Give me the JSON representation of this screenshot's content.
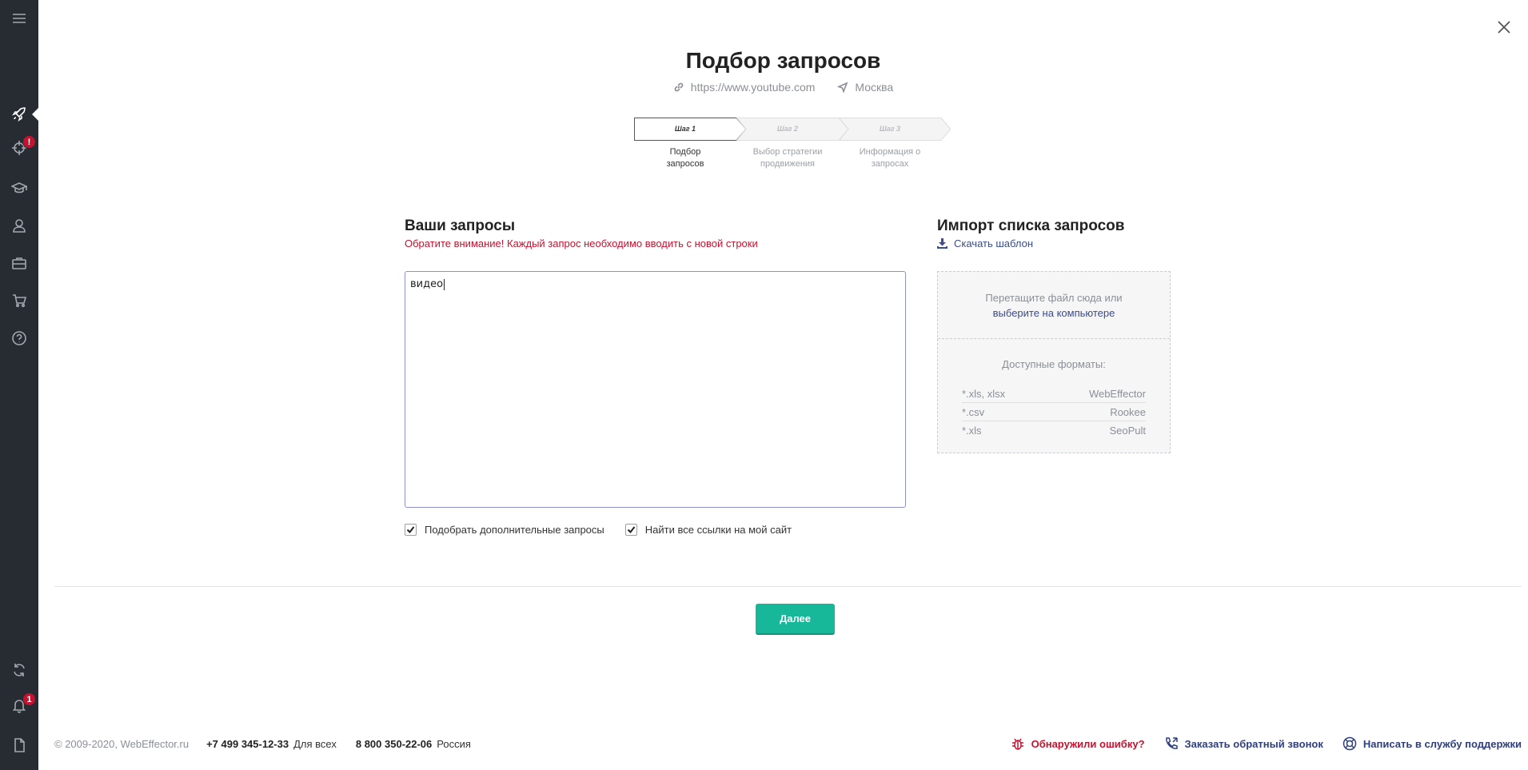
{
  "page": {
    "title": "Подбор запросов",
    "site_url": "https://www.youtube.com",
    "region": "Москва"
  },
  "steps": [
    {
      "label": "Шаг 1",
      "desc_line1": "Подбор",
      "desc_line2": "запросов",
      "active": true
    },
    {
      "label": "Шаг 2",
      "desc_line1": "Выбор стратегии",
      "desc_line2": "продвижения",
      "active": false
    },
    {
      "label": "Шаг 3",
      "desc_line1": "Информация о",
      "desc_line2": "запросах",
      "active": false
    }
  ],
  "queries": {
    "title": "Ваши запросы",
    "warning": "Обратите внимание! Каждый запрос необходимо вводить с новой строки",
    "value": "видео"
  },
  "options": {
    "extra_queries_label": "Подобрать дополнительные запросы",
    "extra_queries_checked": true,
    "find_links_label": "Найти все ссылки на мой сайт",
    "find_links_checked": true
  },
  "import": {
    "title": "Импорт списка запросов",
    "download_template": "Скачать шаблон",
    "drop_text": "Перетащите файл сюда или",
    "choose_link": "выберите на компьютере",
    "formats_title": "Доступные форматы:",
    "formats": [
      {
        "ext": "*.xls, xlsx",
        "source": "WebEffector"
      },
      {
        "ext": "*.csv",
        "source": "Rookee"
      },
      {
        "ext": "*.xls",
        "source": "SeoPult"
      }
    ]
  },
  "actions": {
    "next_label": "Далее"
  },
  "sidebar": {
    "badge_targets": "!",
    "badge_notifications": "1"
  },
  "footer": {
    "copyright": "© 2009-2020, WebEffector.ru",
    "phone1": "+7 499 345-12-33",
    "phone1_note": "Для всех",
    "phone2": "8 800 350-22-06",
    "phone2_note": "Россия",
    "report_bug": "Обнаружили ошибку?",
    "callback": "Заказать обратный звонок",
    "support": "Написать в службу поддержки"
  },
  "colors": {
    "sidebar_bg": "#272c33",
    "accent_green": "#17b89a",
    "warning_red": "#c4122f",
    "link_blue": "#3b4c8a"
  }
}
